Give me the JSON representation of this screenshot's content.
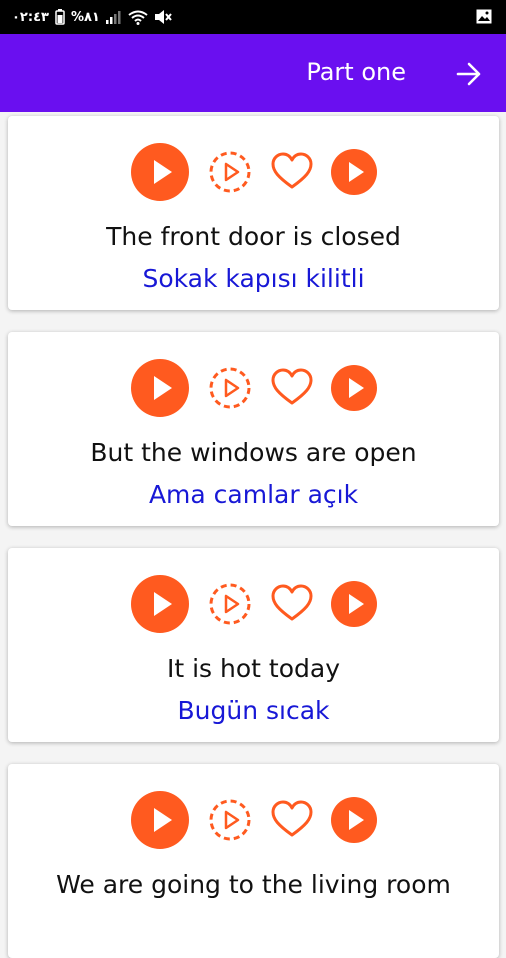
{
  "status_bar": {
    "time": "٠٢:٤٣",
    "battery": "%٨١"
  },
  "app_bar": {
    "title": "Part one",
    "forward_icon": "arrow-right-icon"
  },
  "colors": {
    "app_bar": "#6a0ff0",
    "accent": "#ff5a1f",
    "translation": "#1818d6"
  },
  "cards": [
    {
      "english": "The front door is closed",
      "turkish": "Sokak kapısı kilitli"
    },
    {
      "english": "But the windows are open",
      "turkish": "Ama camlar açık"
    },
    {
      "english": "It is hot today",
      "turkish": "Bugün sıcak"
    },
    {
      "english": "We are going to the living room",
      "turkish": ""
    }
  ],
  "card_icons": [
    "play-icon",
    "slow-play-icon",
    "heart-icon",
    "play-small-icon"
  ]
}
